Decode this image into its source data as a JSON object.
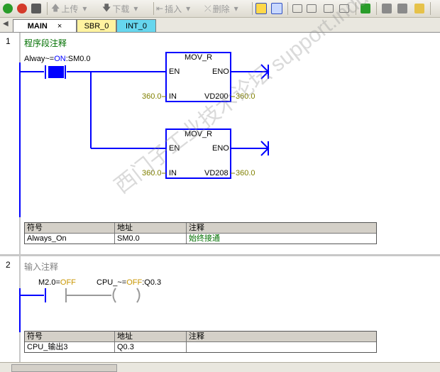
{
  "toolbar": {
    "upload": "上传",
    "download": "下载",
    "insert": "插入",
    "delete": "删除"
  },
  "tabs": [
    {
      "label": "MAIN",
      "close": "×"
    },
    {
      "label": "SBR_0"
    },
    {
      "label": "INT_0"
    }
  ],
  "networks": [
    {
      "number": "1",
      "title": "程序段注释",
      "contact_label": "Alway~=",
      "contact_state": "ON",
      "contact_addr": ":SM0.0",
      "boxes": [
        {
          "name": "MOV_R",
          "en": "EN",
          "eno": "ENO",
          "in_pin": "IN",
          "out_pin": "VD200",
          "in_val": "360.0",
          "out_val": "360.0"
        },
        {
          "name": "MOV_R",
          "en": "EN",
          "eno": "ENO",
          "in_pin": "IN",
          "out_pin": "VD208",
          "in_val": "360.0",
          "out_val": "360.0"
        }
      ],
      "symbols": {
        "headers": [
          "符号",
          "地址",
          "注释"
        ],
        "rows": [
          [
            "Always_On",
            "SM0.0",
            "始终接通"
          ]
        ]
      }
    },
    {
      "number": "2",
      "title": "输入注释",
      "contact_label": "M2.0=",
      "contact_state": "OFF",
      "coil_label": "CPU_~=",
      "coil_state": "OFF",
      "coil_addr": ":Q0.3",
      "symbols": {
        "headers": [
          "符号",
          "地址",
          "注释"
        ],
        "rows": [
          [
            "CPU_输出3",
            "Q0.3",
            ""
          ]
        ]
      }
    }
  ],
  "watermark": "西门子工业技术论坛 support.industry.siemens.com/cs",
  "colors": {
    "wire": "#0000ff",
    "on_state": "#0000ff",
    "off_state": "#c89600",
    "value": "#808000",
    "comment": "#007000"
  }
}
